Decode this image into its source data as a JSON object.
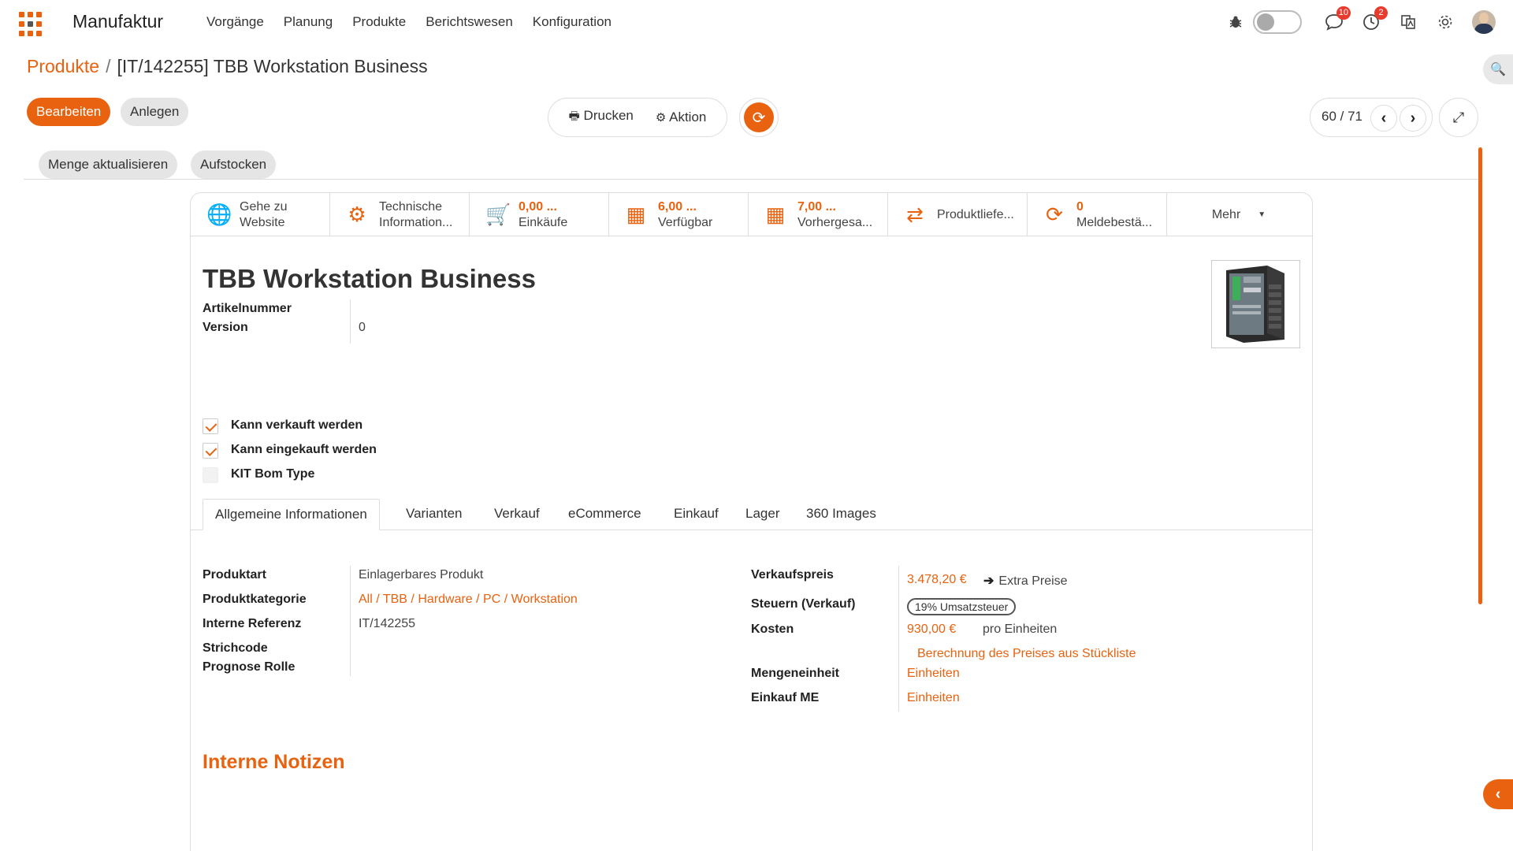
{
  "app": {
    "brand": "Manufaktur",
    "menu": [
      "Vorgänge",
      "Planung",
      "Produkte",
      "Berichtswesen",
      "Konfiguration"
    ],
    "badges": {
      "messages": "10",
      "activities": "2"
    }
  },
  "breadcrumb": {
    "parent": "Produkte",
    "separator": "/",
    "current": "[IT/142255] TBB Workstation Business"
  },
  "control_panel": {
    "edit": "Bearbeiten",
    "create": "Anlegen",
    "print": "Drucken",
    "action": "Aktion",
    "update_qty": "Menge aktualisieren",
    "replenish": "Aufstocken",
    "pager": "60 / 71"
  },
  "smart_buttons": [
    {
      "icon": "globe-icon",
      "value": "",
      "label1": "Gehe zu",
      "label2": "Website"
    },
    {
      "icon": "gears-icon",
      "value": "",
      "label1": "Technische",
      "label2": "Information..."
    },
    {
      "icon": "cart-icon",
      "value": "0,00 ...",
      "label1": "",
      "label2": "Einkäufe"
    },
    {
      "icon": "cubes-icon",
      "value": "6,00 ...",
      "label1": "",
      "label2": "Verfügbar"
    },
    {
      "icon": "cubes-icon",
      "value": "7,00 ...",
      "label1": "",
      "label2": "Vorhergesa..."
    },
    {
      "icon": "exchange-icon",
      "value": "",
      "label1": "Produktliefe...",
      "label2": ""
    },
    {
      "icon": "refresh-icon",
      "value": "0",
      "label1": "",
      "label2": "Meldebestä..."
    }
  ],
  "more_label": "Mehr",
  "product": {
    "name": "TBB Workstation Business",
    "article_number_label": "Artikelnummer",
    "version_label": "Version",
    "version_value": "0",
    "checkboxes": [
      {
        "label": "Kann verkauft werden",
        "checked": true
      },
      {
        "label": "Kann eingekauft werden",
        "checked": true
      },
      {
        "label": "KIT Bom Type",
        "checked": false
      }
    ]
  },
  "tabs": [
    "Allgemeine Informationen",
    "Varianten",
    "Verkauf",
    "eCommerce",
    "Einkauf",
    "Lager",
    "360 Images"
  ],
  "general": {
    "left": {
      "product_type_label": "Produktart",
      "product_type": "Einlagerbares Produkt",
      "category_label": "Produktkategorie",
      "category": [
        "All",
        "TBB",
        "Hardware",
        "PC",
        "Workstation"
      ],
      "category_sep": "/",
      "internal_ref_label": "Interne Referenz",
      "internal_ref": "IT/142255",
      "barcode_label": "Strichcode",
      "forecast_role_label": "Prognose Rolle"
    },
    "right": {
      "sales_price_label": "Verkaufspreis",
      "sales_price": "3.478,20 €",
      "extra_prices": "Extra Preise",
      "taxes_label": "Steuern (Verkauf)",
      "tax_tag": "19% Umsatzsteuer",
      "cost_label": "Kosten",
      "cost": "930,00 €",
      "cost_unit": "pro Einheiten",
      "compute_from_bom": "Berechnung des Preises aus Stückliste",
      "uom_label": "Mengeneinheit",
      "uom": "Einheiten",
      "purchase_uom_label": "Einkauf ME",
      "purchase_uom": "Einheiten"
    }
  },
  "notes_title": "Interne Notizen",
  "colors": {
    "accent": "#e8620f",
    "badge": "#e83b2e"
  }
}
